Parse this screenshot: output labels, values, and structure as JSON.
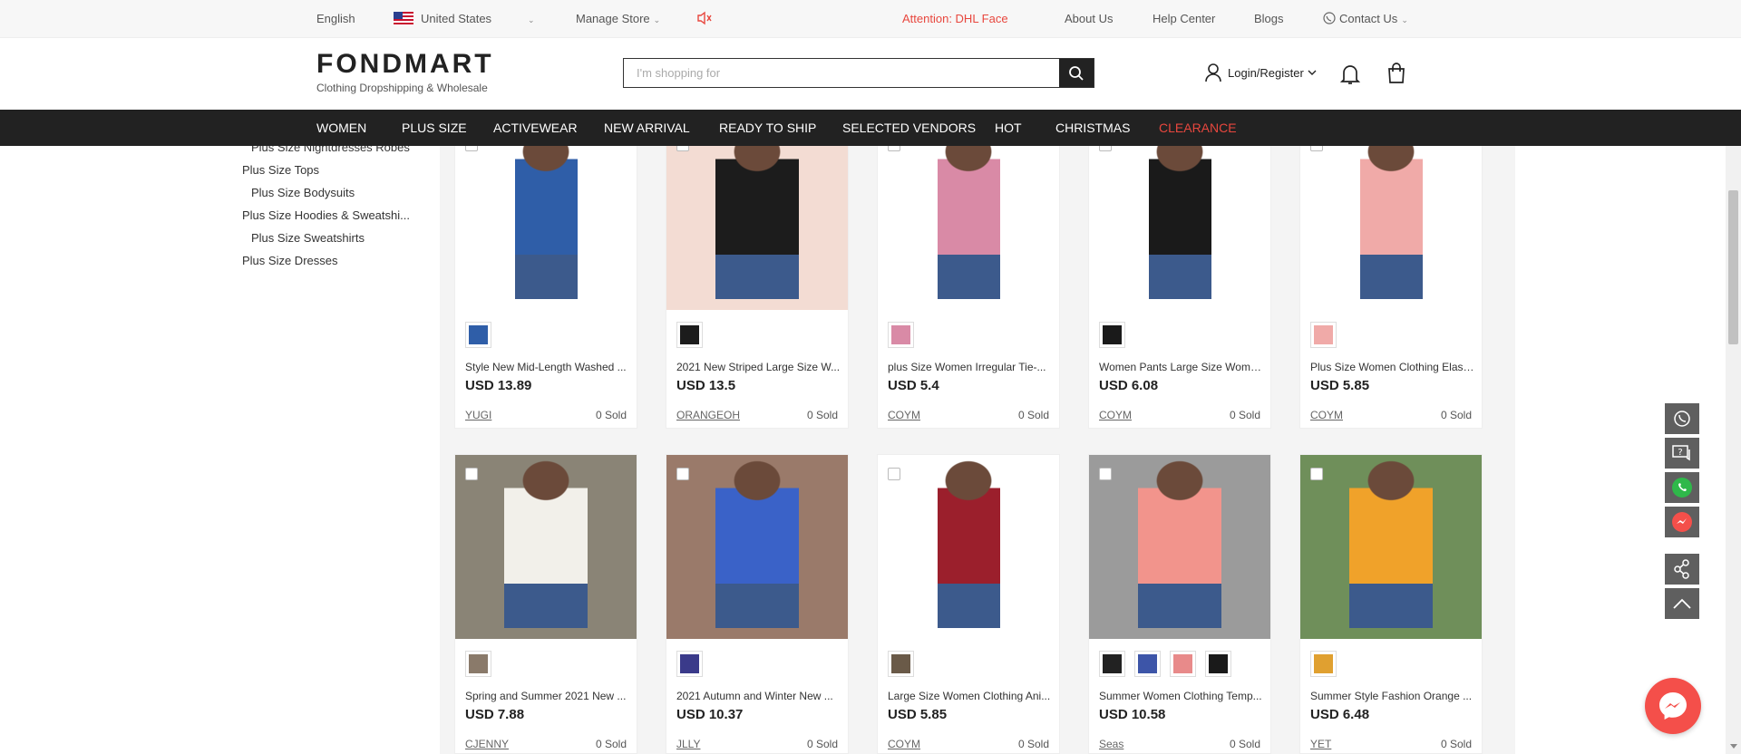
{
  "topbar": {
    "language": "English",
    "country": "United States",
    "manage_store": "Manage Store",
    "attention": "Attention: DHL Face",
    "about": "About Us",
    "help": "Help Center",
    "blogs": "Blogs",
    "contact": "Contact Us"
  },
  "header": {
    "logo": "FONDMART",
    "tagline": "Clothing Dropshipping & Wholesale",
    "search_placeholder": "I'm shopping for",
    "login": "Login/Register"
  },
  "nav": {
    "items": [
      "WOMEN",
      "PLUS SIZE",
      "ACTIVEWEAR",
      "NEW ARRIVAL",
      "READY TO SHIP",
      "SELECTED VENDORS",
      "HOT",
      "CHRISTMAS",
      "CLEARANCE"
    ]
  },
  "sidebar": {
    "items": [
      "Plus Size Nightdresses Robes",
      "Plus Size Tops",
      "Plus Size Bodysuits",
      "Plus Size Hoodies & Sweatshi...",
      "Plus Size Sweatshirts",
      "Plus Size Dresses"
    ]
  },
  "products": [
    {
      "title": "Style New Mid-Length Washed ...",
      "price": "USD 13.89",
      "vendor": "YUGI",
      "sold": "0 Sold",
      "color": "#2f5ea8",
      "bg": "#ffffff",
      "thumbs": [
        "#2f5ea8"
      ]
    },
    {
      "title": "2021 New Striped Large Size W...",
      "price": "USD 13.5",
      "vendor": "ORANGEOH",
      "sold": "0 Sold",
      "color": "#1c1c1c",
      "bg": "#f3dcd3",
      "thumbs": [
        "#1c1c1c"
      ]
    },
    {
      "title": "plus Size Women Irregular Tie-...",
      "price": "USD 5.4",
      "vendor": "COYM",
      "sold": "0 Sold",
      "color": "#d98aa6",
      "bg": "#ffffff",
      "thumbs": [
        "#d98aa6"
      ]
    },
    {
      "title": "Women Pants Large Size Wome...",
      "price": "USD 6.08",
      "vendor": "COYM",
      "sold": "0 Sold",
      "color": "#1a1a1a",
      "bg": "#ffffff",
      "thumbs": [
        "#1a1a1a"
      ]
    },
    {
      "title": "Plus Size Women Clothing Elasti...",
      "price": "USD 5.85",
      "vendor": "COYM",
      "sold": "0 Sold",
      "color": "#f0aaa8",
      "bg": "#ffffff",
      "thumbs": [
        "#f0aaa8"
      ]
    },
    {
      "title": "Spring and Summer 2021 New ...",
      "price": "USD 7.88",
      "vendor": "CJENNY",
      "sold": "0 Sold",
      "color": "#f2f0ea",
      "bg": "#8a8476",
      "thumbs": [
        "#8a7a6a"
      ]
    },
    {
      "title": "2021 Autumn and Winter New ...",
      "price": "USD 10.37",
      "vendor": "JLLY",
      "sold": "0 Sold",
      "color": "#3a62c8",
      "bg": "#9a7a6a",
      "thumbs": [
        "#3a3a8a"
      ]
    },
    {
      "title": "Large Size Women Clothing Ani...",
      "price": "USD 5.85",
      "vendor": "COYM",
      "sold": "0 Sold",
      "color": "#9b1f2c",
      "bg": "#ffffff",
      "thumbs": [
        "#6a5a48"
      ]
    },
    {
      "title": "Summer Women Clothing Temp...",
      "price": "USD 10.58",
      "vendor": "Seas",
      "sold": "0 Sold",
      "color": "#f2948c",
      "bg": "#9b9b9b",
      "thumbs": [
        "#222222",
        "#3d55a8",
        "#e88a8a",
        "#1a1a1a"
      ]
    },
    {
      "title": "Summer Style Fashion Orange ...",
      "price": "USD 6.48",
      "vendor": "YET",
      "sold": "0 Sold",
      "color": "#f0a22a",
      "bg": "#6f8f5a",
      "thumbs": [
        "#e0a030"
      ]
    }
  ],
  "colors": {
    "accent": "#e8473e",
    "nav_bg": "#222222",
    "tool_bg": "#5f5f5f",
    "whatsapp": "#2fb84a",
    "messenger": "#f44f4a"
  }
}
